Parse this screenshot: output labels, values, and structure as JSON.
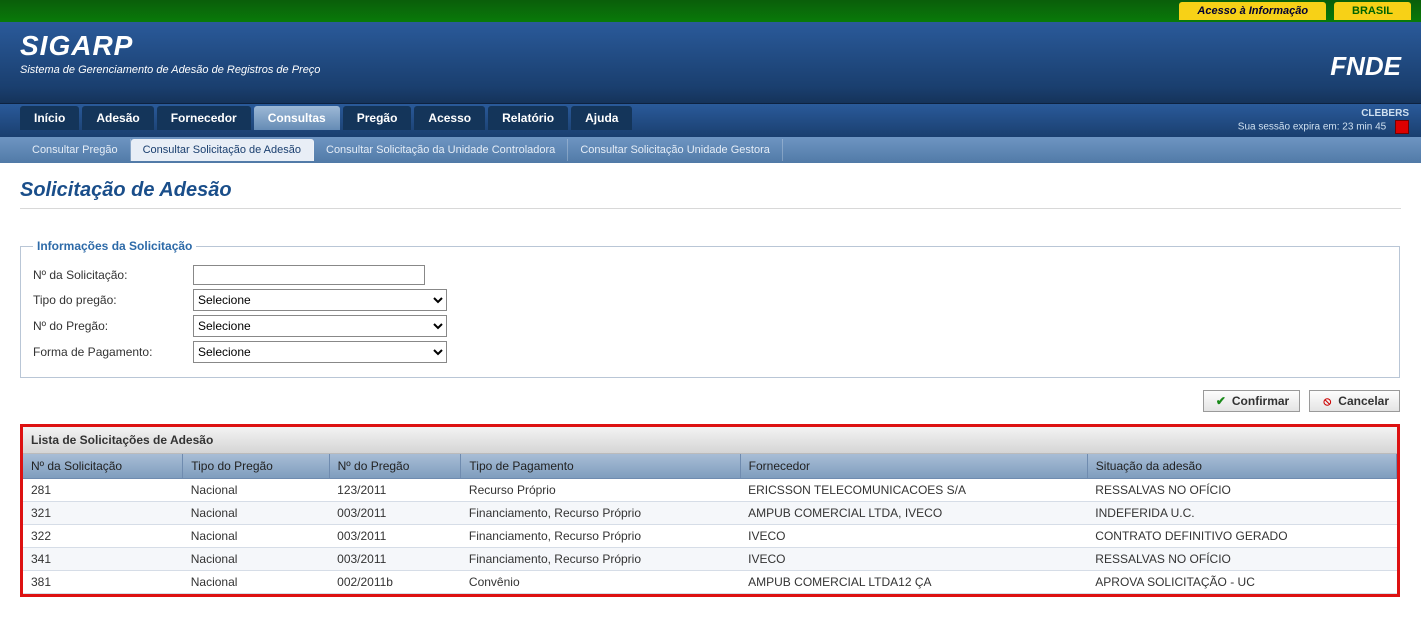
{
  "topbar": {
    "access_info": "Acesso à Informação",
    "brasil": "BRASIL"
  },
  "header": {
    "app_title": "SIGARP",
    "app_sub": "Sistema de Gerenciamento de Adesão de Registros de Preço",
    "fnde": "FNDE"
  },
  "session": {
    "user": "CLEBERS",
    "expires": "Sua sessão expira em: 23 min 45"
  },
  "menu": {
    "items": [
      {
        "label": "Início"
      },
      {
        "label": "Adesão"
      },
      {
        "label": "Fornecedor"
      },
      {
        "label": "Consultas",
        "active": true
      },
      {
        "label": "Pregão"
      },
      {
        "label": "Acesso"
      },
      {
        "label": "Relatório"
      },
      {
        "label": "Ajuda"
      }
    ]
  },
  "submenu": {
    "items": [
      {
        "label": "Consultar Pregão"
      },
      {
        "label": "Consultar Solicitação de Adesão",
        "active": true
      },
      {
        "label": "Consultar Solicitação da Unidade Controladora"
      },
      {
        "label": "Consultar Solicitação Unidade Gestora"
      }
    ]
  },
  "page": {
    "title": "Solicitação de Adesão"
  },
  "form": {
    "legend": "Informações da Solicitação",
    "num_solic_label": "Nº da Solicitação:",
    "num_solic_value": "",
    "tipo_pregao_label": "Tipo do pregão:",
    "tipo_pregao_value": "Selecione",
    "num_pregao_label": "Nº do Pregão:",
    "num_pregao_value": "Selecione",
    "forma_pag_label": "Forma de Pagamento:",
    "forma_pag_value": "Selecione"
  },
  "buttons": {
    "confirm": "Confirmar",
    "cancel": "Cancelar"
  },
  "list": {
    "title": "Lista de Solicitações de Adesão",
    "columns": [
      "Nº da Solicitação",
      "Tipo do Pregão",
      "Nº do Pregão",
      "Tipo de Pagamento",
      "Fornecedor",
      "Situação da adesão"
    ],
    "rows": [
      {
        "c": [
          "281",
          "Nacional",
          "123/2011",
          "Recurso Próprio",
          "ERICSSON TELECOMUNICACOES S/A",
          "RESSALVAS NO OFÍCIO"
        ]
      },
      {
        "c": [
          "321",
          "Nacional",
          "003/2011",
          "Financiamento, Recurso Próprio",
          "AMPUB COMERCIAL LTDA, IVECO",
          "INDEFERIDA U.C."
        ]
      },
      {
        "c": [
          "322",
          "Nacional",
          "003/2011",
          "Financiamento, Recurso Próprio",
          "IVECO",
          "CONTRATO DEFINITIVO GERADO"
        ]
      },
      {
        "c": [
          "341",
          "Nacional",
          "003/2011",
          "Financiamento, Recurso Próprio",
          "IVECO",
          "RESSALVAS NO OFÍCIO"
        ]
      },
      {
        "c": [
          "381",
          "Nacional",
          "002/2011b",
          "Convênio",
          "AMPUB COMERCIAL LTDA12 ÇA",
          "APROVA SOLICITAÇÃO - UC"
        ]
      }
    ]
  }
}
